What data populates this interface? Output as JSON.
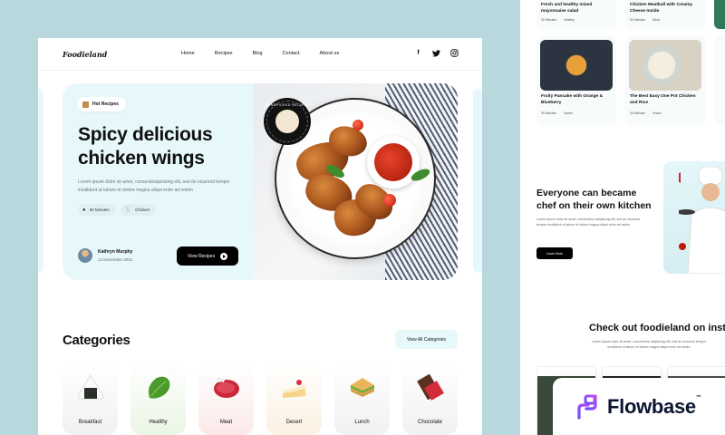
{
  "nav": {
    "logo": "Foodieland",
    "links": [
      "Home",
      "Recipes",
      "Blog",
      "Contact",
      "About us"
    ]
  },
  "hero": {
    "tag": "Hot Recipes",
    "stamp": "HANDPICKED RECIPES",
    "title": "Spicy delicious chicken wings",
    "description": "Lorem ipsum dolor sit amet, consectetuipisicing elit, sed do eiusmod tempor incididunt ut labore et dolore magna aliqut enim ad minim",
    "time": "30 Minutes",
    "category": "Chicken",
    "author_name": "Kathryn Murphy",
    "author_date": "12 November 2021",
    "cta": "View Recipes"
  },
  "categories": {
    "title": "Categories",
    "view_all": "View All Categories",
    "items": [
      {
        "label": "Breakfast",
        "bg": "#f3f3f3"
      },
      {
        "label": "Healthy",
        "bg": "#eef6ea"
      },
      {
        "label": "Meat",
        "bg": "#fbeeee"
      },
      {
        "label": "Desert",
        "bg": "#fbf4e7"
      },
      {
        "label": "Lunch",
        "bg": "#f3f3f3"
      },
      {
        "label": "Chocolate",
        "bg": "#f3f3f3"
      }
    ]
  },
  "right": {
    "top_cards": [
      {
        "title": "Fresh and healthy mixed mayonnaise salad",
        "time": "30 Minutes",
        "cat": "Healthy"
      },
      {
        "title": "Chicken Meatball with Creamy Cheese Inside",
        "time": "30 Minutes",
        "cat": "Meat"
      }
    ],
    "cards": [
      {
        "title": "Fruity Pancake with Orange & Blueberry",
        "time": "30 Minutes",
        "cat": "Sweet"
      },
      {
        "title": "The Best Easy One Pot Chicken and Rice",
        "time": "30 Minutes",
        "cat": "Snack"
      }
    ],
    "chef_title": "Everyone can became chef on their own kitchen",
    "chef_desc": "Lorem ipsum dolor sit amet, consectetur adipiscing elit, sed do eiusmod tempor incididunt ut labore et dolore magna aliqut enim ad minim",
    "learn_more": "Learn More",
    "insta_title": "Check out foodieland on instagram",
    "insta_desc": "Lorem ipsum dolor sit amet, consectetur adipiscing elit, sed do eiusmod tempor incididunt ut labore et dolore magna aliqut enim ad minim"
  },
  "flowbase": {
    "name": "Flowbase",
    "tm": "™"
  }
}
